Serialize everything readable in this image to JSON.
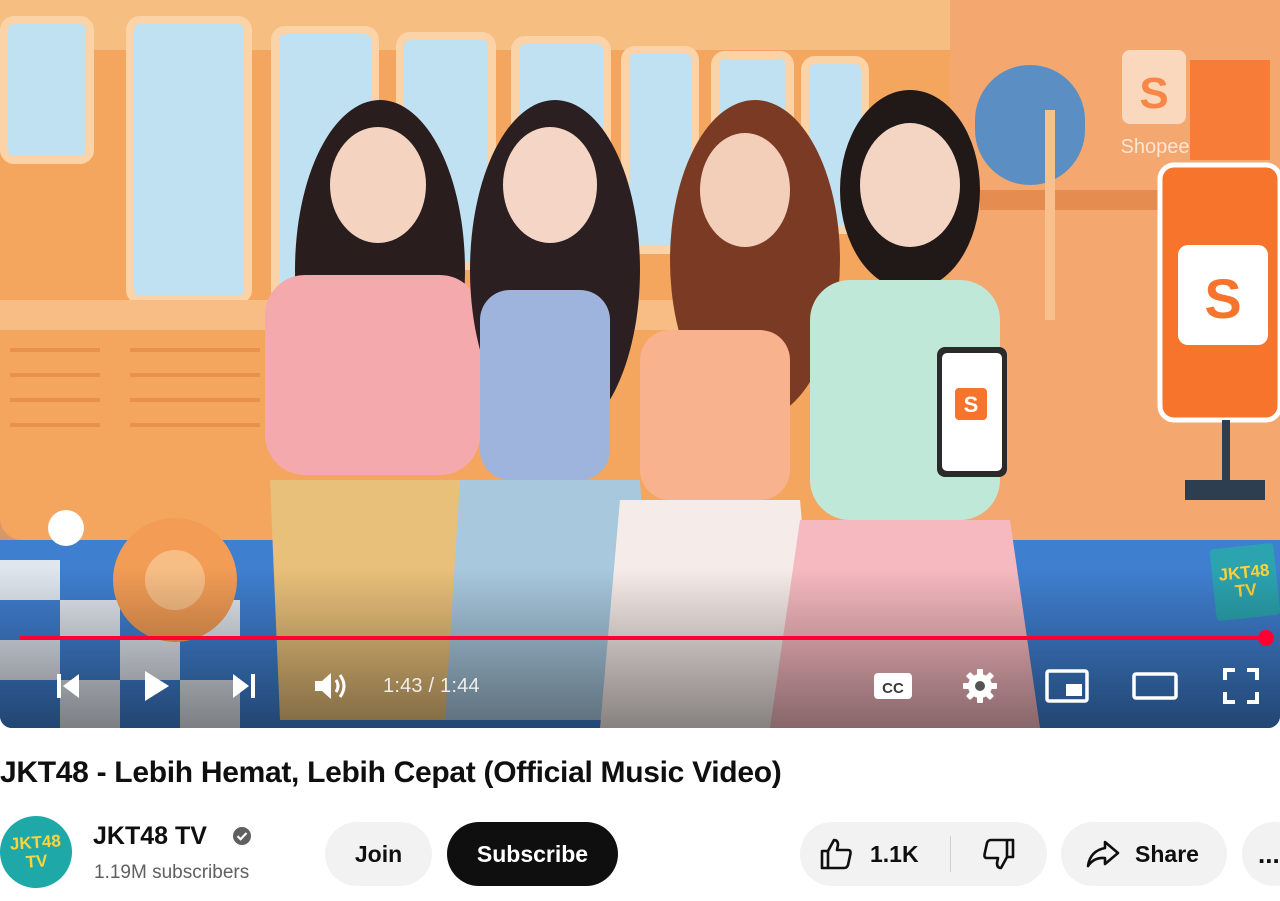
{
  "player": {
    "current_time": "1:43",
    "separator": " / ",
    "duration": "1:44",
    "progress_fraction": 0.998,
    "accent_color": "#ff0033",
    "brand_sign_text": "Shopee",
    "watermark_line1": "JKT48",
    "watermark_line2": "TV",
    "controls": {
      "previous_icon": "skip-previous-icon",
      "play_icon": "play-icon",
      "next_icon": "skip-next-icon",
      "volume_icon": "volume-icon",
      "captions_icon": "closed-captions-icon",
      "settings_icon": "gear-icon",
      "miniplayer_icon": "miniplayer-icon",
      "theater_icon": "theater-mode-icon",
      "fullscreen_icon": "fullscreen-icon"
    }
  },
  "video": {
    "title": "JKT48 - Lebih Hemat, Lebih Cepat (Official Music Video)"
  },
  "channel": {
    "name": "JKT48 TV",
    "subscribers": "1.19M subscribers",
    "avatar_line1": "JKT48",
    "avatar_line2": "TV",
    "verified_icon": "verified-check-icon"
  },
  "actions": {
    "join_label": "Join",
    "subscribe_label": "Subscribe",
    "like_count": "1.1K",
    "like_icon": "thumbs-up-icon",
    "dislike_icon": "thumbs-down-icon",
    "share_label": "Share",
    "share_icon": "share-arrow-icon",
    "more_label": "..."
  }
}
